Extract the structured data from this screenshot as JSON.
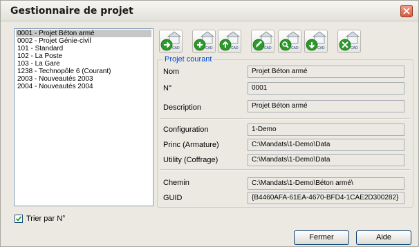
{
  "window": {
    "title": "Gestionnaire de projet"
  },
  "projects": [
    "0001 - Projet Béton armé",
    "0002 - Projet Génie-civil",
    "101 - Standard",
    "102 - La Poste",
    "103 - La Gare",
    "1238 - Technopôle 6  (Courant)",
    "2003 - Nouveautés 2003",
    "2004 - Nouveautés 2004"
  ],
  "selected_index": 0,
  "sort_checkbox": {
    "label": "Trier par N°",
    "checked": true
  },
  "toolbar": {
    "icon_text": "CAD",
    "buttons": [
      {
        "name": "open-project",
        "icon": "arrow-right-icon",
        "color": "#2a9a2a"
      },
      {
        "name": "new-project",
        "icon": "plus-icon",
        "color": "#2a9a2a"
      },
      {
        "name": "upload-project",
        "icon": "arrow-up-icon",
        "color": "#2a9a2a"
      },
      {
        "name": "edit-project",
        "icon": "edit-icon",
        "color": "#2a9a2a"
      },
      {
        "name": "search-project",
        "icon": "search-icon",
        "color": "#2a9a2a"
      },
      {
        "name": "download-project",
        "icon": "arrow-down-icon",
        "color": "#2a9a2a"
      },
      {
        "name": "tools-project",
        "icon": "tools-icon",
        "color": "#2a9a2a"
      }
    ]
  },
  "current_project": {
    "legend": "Projet courant",
    "fields": [
      {
        "label": "Nom",
        "value": "Projet Béton armé"
      },
      {
        "label": "N°",
        "value": "0001"
      },
      {
        "label": "Description",
        "value": "Projet Béton armé"
      },
      {
        "label": "Configuration",
        "value": "1-Demo"
      },
      {
        "label": "Princ (Armature)",
        "value": "C:\\Mandats\\1-Demo\\Data"
      },
      {
        "label": "Utility (Coffrage)",
        "value": "C:\\Mandats\\1-Demo\\Data"
      },
      {
        "label": "Chemin",
        "value": "C:\\Mandats\\1-Demo\\Béton armé\\"
      },
      {
        "label": "GUID",
        "value": "{B4460AFA-61EA-4670-BFD4-1CAE2D300282}"
      }
    ]
  },
  "buttons": {
    "close": "Fermer",
    "help": "Aide"
  },
  "colors": {
    "accent": "#0046d5",
    "selection": "#c7c7c7",
    "icon_green": "#2a9a2a"
  }
}
